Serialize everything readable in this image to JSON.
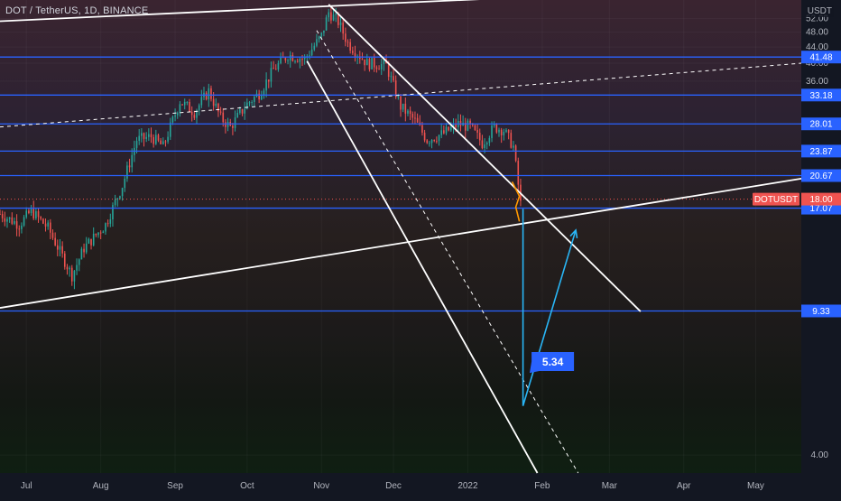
{
  "header": {
    "symbol_title": "DOT / TetherUS, 1D, BINANCE",
    "quote_unit": "USDT"
  },
  "colors": {
    "background": "#131722",
    "up_candle": "#26a69a",
    "down_candle": "#ef5350",
    "level_line": "#2962ff",
    "channel_line": "#ffffff",
    "price_tag": "#ef5350",
    "level_tag": "#2962ff",
    "projection": "#29b6f6",
    "orange_mark": "#ff9800"
  },
  "chart_data": {
    "type": "candlestick",
    "y_scale": "log",
    "ylim": [
      3.6,
      58
    ],
    "y_ticks": [
      {
        "value": 52,
        "label": "52.00"
      },
      {
        "value": 48,
        "label": "48.00"
      },
      {
        "value": 44,
        "label": "44.00"
      },
      {
        "value": 40,
        "label": "40.00"
      },
      {
        "value": 36,
        "label": "36.00"
      },
      {
        "value": 4,
        "label": "4.00"
      }
    ],
    "x_ticks": [
      {
        "date": "2021-07-01",
        "label": "Jul"
      },
      {
        "date": "2021-08-01",
        "label": "Aug"
      },
      {
        "date": "2021-09-01",
        "label": "Sep"
      },
      {
        "date": "2021-10-01",
        "label": "Oct"
      },
      {
        "date": "2021-11-01",
        "label": "Nov"
      },
      {
        "date": "2021-12-01",
        "label": "Dec"
      },
      {
        "date": "2022-01-01",
        "label": "2022"
      },
      {
        "date": "2022-02-01",
        "label": "Feb"
      },
      {
        "date": "2022-03-01",
        "label": "Mar"
      },
      {
        "date": "2022-04-01",
        "label": "Apr"
      },
      {
        "date": "2022-05-01",
        "label": "May"
      }
    ],
    "xlim": [
      "2021-06-20",
      "2022-05-20"
    ],
    "price_anchors": [
      [
        "2021-06-20",
        16.5
      ],
      [
        "2021-06-28",
        15.5
      ],
      [
        "2021-07-03",
        16.8
      ],
      [
        "2021-07-10",
        15.2
      ],
      [
        "2021-07-20",
        11.5
      ],
      [
        "2021-07-25",
        13.5
      ],
      [
        "2021-08-03",
        15.5
      ],
      [
        "2021-08-10",
        19.5
      ],
      [
        "2021-08-16",
        25.5
      ],
      [
        "2021-08-22",
        26.0
      ],
      [
        "2021-08-27",
        24.5
      ],
      [
        "2021-09-03",
        32.0
      ],
      [
        "2021-09-09",
        30.0
      ],
      [
        "2021-09-15",
        34.0
      ],
      [
        "2021-09-20",
        29.0
      ],
      [
        "2021-09-24",
        27.5
      ],
      [
        "2021-10-01",
        31.5
      ],
      [
        "2021-10-06",
        33.5
      ],
      [
        "2021-10-12",
        38.5
      ],
      [
        "2021-10-18",
        42.0
      ],
      [
        "2021-10-25",
        41.0
      ],
      [
        "2021-11-01",
        47.0
      ],
      [
        "2021-11-04",
        54.0
      ],
      [
        "2021-11-08",
        51.0
      ],
      [
        "2021-11-12",
        45.0
      ],
      [
        "2021-11-20",
        40.0
      ],
      [
        "2021-11-28",
        39.5
      ],
      [
        "2021-12-04",
        31.0
      ],
      [
        "2021-12-10",
        28.5
      ],
      [
        "2021-12-15",
        25.5
      ],
      [
        "2021-12-22",
        26.5
      ],
      [
        "2021-12-28",
        28.0
      ],
      [
        "2022-01-02",
        27.5
      ],
      [
        "2022-01-07",
        25.0
      ],
      [
        "2022-01-12",
        27.5
      ],
      [
        "2022-01-16",
        27.0
      ],
      [
        "2022-01-20",
        24.5
      ],
      [
        "2022-01-23",
        17.5
      ]
    ],
    "horizontal_levels": [
      {
        "value": 41.48,
        "label": "41.48"
      },
      {
        "value": 33.18,
        "label": "33.18"
      },
      {
        "value": 28.01,
        "label": "28.01"
      },
      {
        "value": 23.87,
        "label": "23.87"
      },
      {
        "value": 20.67,
        "label": "20.67"
      },
      {
        "value": 17.07,
        "label": "17.07"
      },
      {
        "value": 9.33,
        "label": "9.33"
      }
    ],
    "last_price": {
      "symbol": "DOTUSDT",
      "value": 18.0,
      "label": "18.00"
    },
    "channel_lines": [
      {
        "from": [
          "2021-06-20",
          51.2
        ],
        "to": [
          "2022-02-07",
          59.5
        ],
        "style": "solid"
      },
      {
        "from": [
          "2021-06-20",
          9.5
        ],
        "to": [
          "2022-05-20",
          20.3
        ],
        "style": "solid"
      },
      {
        "from": [
          "2021-06-20",
          27.5
        ],
        "to": [
          "2022-05-20",
          40.0
        ],
        "style": "dashed"
      },
      {
        "from": [
          "2021-11-04",
          56.5
        ],
        "to": [
          "2022-03-14",
          9.3
        ],
        "style": "solid"
      },
      {
        "from": [
          "2021-10-26",
          40.5
        ],
        "to": [
          "2022-01-30",
          3.6
        ],
        "style": "solid"
      },
      {
        "from": [
          "2021-10-30",
          48.5
        ],
        "to": [
          "2022-02-16",
          3.6
        ],
        "style": "dashed"
      }
    ],
    "projection": {
      "drop_from": [
        "2022-01-24",
        17.0
      ],
      "drop_to": [
        "2022-01-24",
        5.34
      ],
      "rise_to": [
        "2022-02-15",
        15.0
      ],
      "label": "5.34"
    }
  }
}
